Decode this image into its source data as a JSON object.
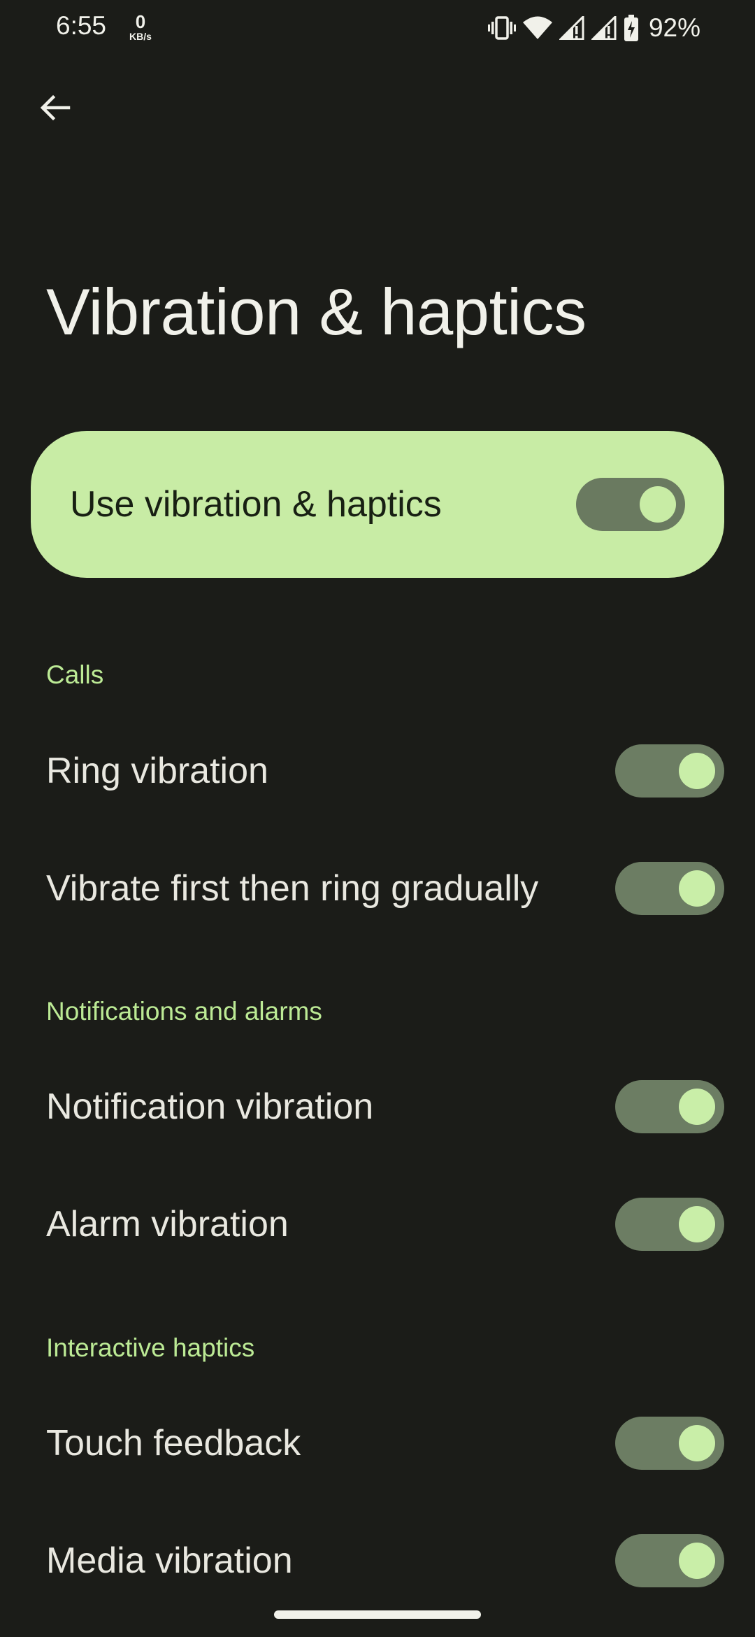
{
  "status_bar": {
    "time": "6:55",
    "net_speed_value": "0",
    "net_speed_unit": "KB/s",
    "icons": [
      "vibrate-icon",
      "wifi-icon",
      "signal-icon",
      "signal-icon",
      "battery-charging-icon"
    ],
    "battery_percent": "92%"
  },
  "header": {
    "back_icon": "arrow-back-icon",
    "title": "Vibration & haptics"
  },
  "main_toggle": {
    "label": "Use vibration & haptics",
    "on": true
  },
  "sections": [
    {
      "header": "Calls",
      "items": [
        {
          "label": "Ring vibration",
          "on": true
        },
        {
          "label": "Vibrate first then ring gradually",
          "on": true
        }
      ]
    },
    {
      "header": "Notifications and alarms",
      "items": [
        {
          "label": "Notification vibration",
          "on": true
        },
        {
          "label": "Alarm vibration",
          "on": true
        }
      ]
    },
    {
      "header": "Interactive haptics",
      "items": [
        {
          "label": "Touch feedback",
          "on": true
        },
        {
          "label": "Media vibration",
          "on": true
        }
      ]
    }
  ],
  "colors": {
    "background": "#1b1c18",
    "accent": "#c8eca5",
    "section_header": "#bcea95",
    "toggle_track": "#6c7d63"
  }
}
